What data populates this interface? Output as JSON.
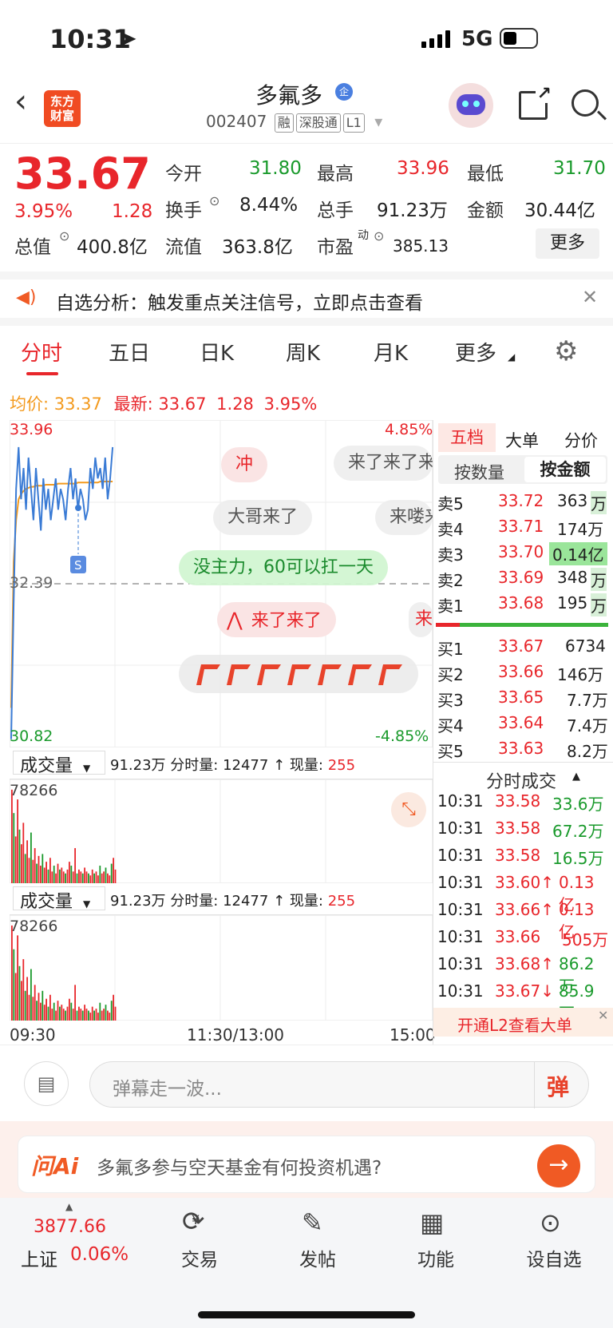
{
  "status_bar": {
    "time": "10:31",
    "network": "5G"
  },
  "header": {
    "stock_name": "多氟多",
    "code": "002407",
    "tags": [
      "融",
      "深股通",
      "L1"
    ],
    "badge": "企",
    "logo_text": "东方\n财富"
  },
  "quote": {
    "price": "33.67",
    "change_pct": "3.95%",
    "change": "1.28",
    "open_label": "今开",
    "open": "31.80",
    "high_label": "最高",
    "high": "33.96",
    "low_label": "最低",
    "low": "31.70",
    "turnover_label": "换手",
    "turnover": "8.44%",
    "volume_label": "总手",
    "volume": "91.23万",
    "amount_label": "金额",
    "amount": "30.44亿",
    "mktcap_label": "总值",
    "mktcap": "400.8亿",
    "float_label": "流值",
    "float": "363.8亿",
    "pe_label": "市盈",
    "pe_sup": "动",
    "pe": "385.13",
    "more_button": "更多"
  },
  "alert": {
    "text": "自选分析：触发重点关注信号，立即点击查看"
  },
  "tabs": [
    "分时",
    "五日",
    "日K",
    "周K",
    "月K",
    "更多"
  ],
  "chart_info": {
    "avg_label": "均价:",
    "avg": "33.37",
    "latest_label": "最新:",
    "latest": "33.67",
    "change": "1.28",
    "pct": "3.95%"
  },
  "chart_data": {
    "type": "line",
    "ymax_label": "33.96",
    "ymin_label": "30.82",
    "pct_up": "4.85%",
    "pct_down": "-4.85%",
    "prev_close_label": "32.39",
    "x_labels": [
      "09:30",
      "11:30/13:00",
      "15:00"
    ],
    "price": [
      30.9,
      32.2,
      33.3,
      33.7,
      33.2,
      33.5,
      33.1,
      33.6,
      33.3,
      33.0,
      33.5,
      33.2,
      32.9,
      33.4,
      33.1,
      33.3,
      33.0,
      33.2,
      33.4,
      33.1,
      33.3,
      33.2,
      33.0,
      33.3,
      33.5,
      33.2,
      33.4,
      33.1,
      33.3,
      33.2,
      33.0,
      33.1,
      33.5,
      33.3,
      33.6,
      33.4,
      33.5,
      33.3,
      33.6,
      33.2,
      33.4,
      33.7
    ],
    "avg": [
      31.2,
      32.6,
      33.0,
      33.2,
      33.25,
      33.28,
      33.3,
      33.31,
      33.32,
      33.32,
      33.33,
      33.33,
      33.33,
      33.33,
      33.34,
      33.34,
      33.34,
      33.34,
      33.34,
      33.35,
      33.35,
      33.35,
      33.35,
      33.35,
      33.35,
      33.35,
      33.35,
      33.36,
      33.36,
      33.36,
      33.36,
      33.36,
      33.36,
      33.36,
      33.36,
      33.36,
      33.37,
      33.37,
      33.37,
      33.37,
      33.37,
      33.37
    ]
  },
  "danmu": [
    "冲",
    "来了来了来",
    "大哥来了",
    "来喽来",
    "没主力，60可以扛一天",
    "来了来了",
    "来"
  ],
  "volume_panel": {
    "label": "成交量",
    "total": "91.23万",
    "minute_label": "分时量:",
    "minute": "12477",
    "now_label": "现量:",
    "now": "255",
    "max": "78266"
  },
  "depth": {
    "tabs": [
      "五档",
      "大单",
      "分价"
    ],
    "subtabs": [
      "按数量",
      "按金额"
    ],
    "sells": [
      {
        "label": "卖5",
        "price": "33.72",
        "vol": "363",
        "unit": "万"
      },
      {
        "label": "卖4",
        "price": "33.71",
        "vol": "174万",
        "unit": ""
      },
      {
        "label": "卖3",
        "price": "33.70",
        "vol": "0.14亿",
        "unit": ""
      },
      {
        "label": "卖2",
        "price": "33.69",
        "vol": "348",
        "unit": "万"
      },
      {
        "label": "卖1",
        "price": "33.68",
        "vol": "195",
        "unit": "万"
      }
    ],
    "buys": [
      {
        "label": "买1",
        "price": "33.67",
        "vol": "6734"
      },
      {
        "label": "买2",
        "price": "33.66",
        "vol": "146万"
      },
      {
        "label": "买3",
        "price": "33.65",
        "vol": "7.7万"
      },
      {
        "label": "买4",
        "price": "33.64",
        "vol": "7.4万"
      },
      {
        "label": "买5",
        "price": "33.63",
        "vol": "8.2万"
      }
    ]
  },
  "trades": {
    "title": "分时成交",
    "rows": [
      {
        "time": "10:31",
        "price": "33.58",
        "vol": "33.6万"
      },
      {
        "time": "10:31",
        "price": "33.58",
        "vol": "67.2万"
      },
      {
        "time": "10:31",
        "price": "33.58",
        "vol": "16.5万"
      },
      {
        "time": "10:31",
        "price": "33.60↑",
        "vol": "0.13亿"
      },
      {
        "time": "10:31",
        "price": "33.66↑",
        "vol": "0.13亿"
      },
      {
        "time": "10:31",
        "price": "33.66",
        "vol": "505万"
      },
      {
        "time": "10:31",
        "price": "33.68↑",
        "vol": "86.2万"
      },
      {
        "time": "10:31",
        "price": "33.67↓",
        "vol": "85.9万"
      }
    ],
    "l2_text": "开通L2查看大单"
  },
  "comment": {
    "placeholder": "弹幕走一波...",
    "danmu_btn": "弹"
  },
  "ai": {
    "logo": "问Ai",
    "prompt": "多氟多参与空天基金有何投资机遇?"
  },
  "bottom_nav": {
    "index_value": "3877.66",
    "index_name": "上证",
    "index_pct": "0.06%",
    "items": [
      "交易",
      "发帖",
      "功能",
      "设自选"
    ]
  }
}
